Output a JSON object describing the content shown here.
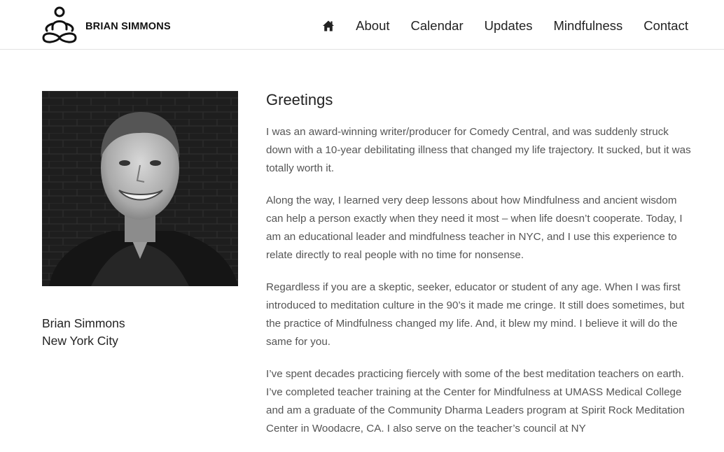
{
  "header": {
    "brand": "BRIAN SIMMONS",
    "nav": [
      "About",
      "Calendar",
      "Updates",
      "Mindfulness",
      "Contact"
    ]
  },
  "profile": {
    "name": "Brian Simmons",
    "location": "New York City"
  },
  "main": {
    "title": "Greetings",
    "paragraphs": [
      "I was an award-winning writer/producer for Comedy Central, and was suddenly struck down with a 10-year debilitating illness that changed my life trajectory. It sucked, but it was totally worth it.",
      "Along the way, I learned very deep lessons about how Mindfulness and ancient wisdom can help a person exactly when they need it most – when life doesn’t cooperate. Today, I am an educational leader and mindfulness teacher in NYC, and I use this experience to relate directly to real people with no time for nonsense.",
      "Regardless if you are a skeptic, seeker, educator or student of any age. When I was first introduced to meditation culture in the 90’s it made me cringe. It still does sometimes, but the practice of Mindfulness changed my life. And, it blew my mind. I believe it will do the same for you.",
      "I’ve spent decades practicing fiercely with some of the best meditation teachers on earth. I’ve completed teacher training at the Center for Mindfulness at UMASS Medical College and am a graduate of the Community Dharma Leaders program at Spirit Rock Meditation Center in Woodacre, CA. I also serve on the teacher’s council at NY"
    ]
  }
}
